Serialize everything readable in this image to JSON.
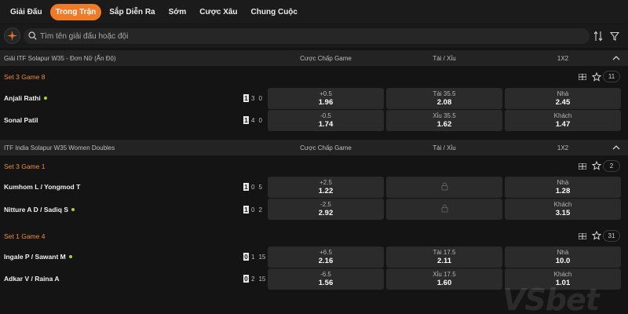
{
  "tabs": [
    {
      "label": "Giải Đấu",
      "active": false
    },
    {
      "label": "Trong Trận",
      "active": true
    },
    {
      "label": "Sắp Diễn Ra",
      "active": false
    },
    {
      "label": "Sớm",
      "active": false
    },
    {
      "label": "Cược Xâu",
      "active": false
    },
    {
      "label": "Chung Cuộc",
      "active": false
    }
  ],
  "search": {
    "placeholder": "Tìm tên giải đấu hoặc đội",
    "value": ""
  },
  "columns": {
    "handicap": "Cược Chấp Game",
    "overunder": "Tài / Xỉu",
    "onextwo": "1X2"
  },
  "leagues": [
    {
      "name": "Giải ITF Solapur W35 - Đơn Nữ (Ấn Độ)",
      "groups": [
        {
          "set_label": "Set 3 Game 8",
          "count": "11",
          "players": [
            {
              "name": "Anjali Rathi",
              "serving": true,
              "scores": [
                "1",
                "3",
                "0"
              ],
              "hcap_label": "+0.5",
              "hcap_odd": "1.96",
              "ou_label": "Tài 35.5",
              "ou_odd": "2.08",
              "x_label": "Nhà",
              "x_odd": "2.45"
            },
            {
              "name": "Sonal Patil",
              "serving": false,
              "scores": [
                "1",
                "4",
                "0"
              ],
              "hcap_label": "-0.5",
              "hcap_odd": "1.74",
              "ou_label": "Xỉu 35.5",
              "ou_odd": "1.62",
              "x_label": "Khách",
              "x_odd": "1.47"
            }
          ]
        }
      ]
    },
    {
      "name": "ITF India Solapur W35 Women Doubles",
      "groups": [
        {
          "set_label": "Set 3 Game 1",
          "count": "2",
          "players": [
            {
              "name": "Kumhom L / Yongmod T",
              "serving": false,
              "scores": [
                "1",
                "0",
                "5"
              ],
              "hcap_label": "+2.5",
              "hcap_odd": "1.22",
              "ou_locked": true,
              "x_label": "Nhà",
              "x_odd": "1.28"
            },
            {
              "name": "Nitture A D / Sadiq S",
              "serving": true,
              "scores": [
                "1",
                "0",
                "2"
              ],
              "hcap_label": "-2.5",
              "hcap_odd": "2.92",
              "ou_locked": true,
              "x_label": "Khách",
              "x_odd": "3.15"
            }
          ]
        },
        {
          "set_label": "Set 1 Game 4",
          "count": "31",
          "players": [
            {
              "name": "Ingale P / Sawant M",
              "serving": true,
              "scores": [
                "0",
                "1",
                "15"
              ],
              "hcap_label": "+6.5",
              "hcap_odd": "2.16",
              "ou_label": "Tài 17.5",
              "ou_odd": "2.11",
              "x_label": "Nhà",
              "x_odd": "10.0"
            },
            {
              "name": "Adkar V / Raina A",
              "serving": false,
              "scores": [
                "0",
                "2",
                "15"
              ],
              "hcap_label": "-6.5",
              "hcap_odd": "1.56",
              "ou_label": "Xỉu 17.5",
              "ou_odd": "1.60",
              "x_label": "Khách",
              "x_odd": "1.01"
            }
          ]
        }
      ]
    }
  ],
  "watermark": "VSbet",
  "colors": {
    "accent": "#f07a26",
    "set_label": "#f08a3a",
    "serve_dot": "#a7d531"
  }
}
